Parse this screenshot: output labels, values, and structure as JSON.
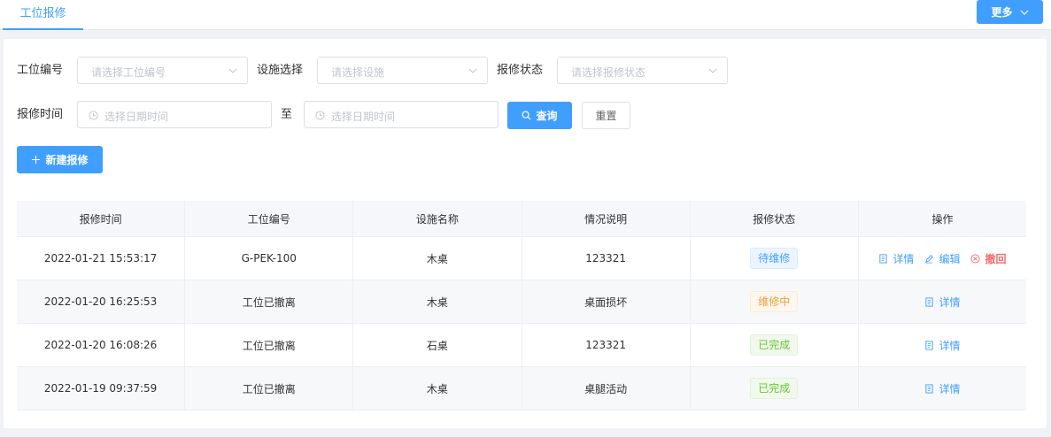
{
  "tabs": {
    "active_label": "工位报修"
  },
  "header": {
    "more_label": "更多"
  },
  "filters": {
    "station_label": "工位编号",
    "station_placeholder": "请选择工位编号",
    "facility_label": "设施选择",
    "facility_placeholder": "请选择设施",
    "status_label": "报修状态",
    "status_placeholder": "请选择报修状态",
    "time_label": "报修时间",
    "start_placeholder": "选择日期时间",
    "to_label": "至",
    "end_placeholder": "选择日期时间",
    "query_label": "查询",
    "reset_label": "重置"
  },
  "actions": {
    "new_label": "新建报修"
  },
  "table": {
    "columns": [
      "报修时间",
      "工位编号",
      "设施名称",
      "情况说明",
      "报修状态",
      "操作"
    ],
    "rows": [
      {
        "time": "2022-01-21 15:53:17",
        "station": "G-PEK-100",
        "facility": "木桌",
        "desc": "123321",
        "status": "待维修",
        "ops": [
          "详情",
          "编辑",
          "撤回"
        ]
      },
      {
        "time": "2022-01-20 16:25:53",
        "station": "工位已撤离",
        "facility": "木桌",
        "desc": "桌面损坏",
        "status": "维修中",
        "ops": [
          "详情"
        ]
      },
      {
        "time": "2022-01-20 16:08:26",
        "station": "工位已撤离",
        "facility": "石桌",
        "desc": "123321",
        "status": "已完成",
        "ops": [
          "详情"
        ]
      },
      {
        "time": "2022-01-19 09:37:59",
        "station": "工位已撤离",
        "facility": "木桌",
        "desc": "桌腿活动",
        "status": "已完成",
        "ops": [
          "详情"
        ]
      }
    ]
  },
  "colors": {
    "primary": "#409eff",
    "danger": "#f56c6c",
    "warning": "#e6a23c",
    "success": "#67c23a"
  }
}
